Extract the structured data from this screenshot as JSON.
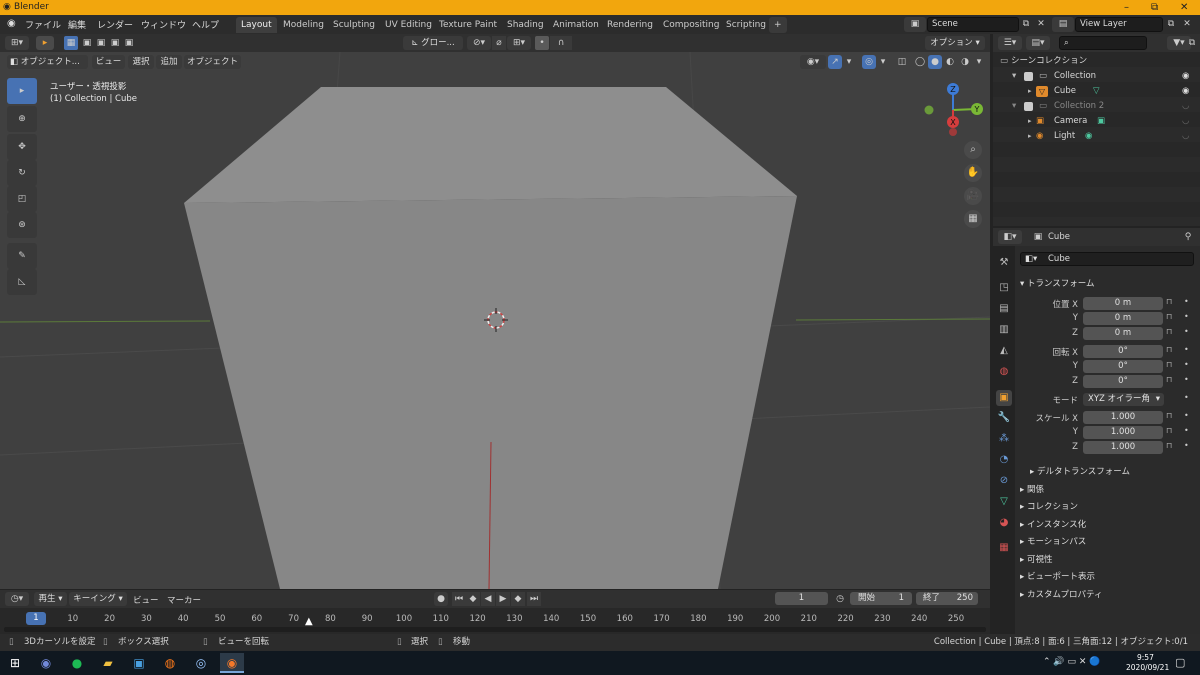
{
  "window": {
    "title": "Blender",
    "minimize": "–",
    "maximize": "⧉",
    "close": "✕"
  },
  "menus": [
    "ファイル",
    "編集",
    "レンダー",
    "ウィンドウ",
    "ヘルプ"
  ],
  "workspaces": [
    "Layout",
    "Modeling",
    "Sculpting",
    "UV Editing",
    "Texture Paint",
    "Shading",
    "Animation",
    "Rendering",
    "Compositing",
    "Scripting"
  ],
  "add_workspace": "+",
  "scene": {
    "name": "Scene",
    "view_layer": "View Layer"
  },
  "viewport_header": {
    "transform_orientation": "グロー...",
    "options": "オプション",
    "mode": "オブジェクト...",
    "menus": [
      "ビュー",
      "選択",
      "追加",
      "オブジェクト"
    ]
  },
  "viewport": {
    "view_name": "ユーザー・透視投影",
    "object_info": "(1) Collection | Cube",
    "gizmo_axes": {
      "z": "Z",
      "x": "X",
      "y": "Y"
    },
    "colors": {
      "background": "#404040",
      "cube_front": "#878787",
      "cube_top": "#8e8e8e",
      "cube_side": "#858585"
    }
  },
  "outliner": {
    "title": "シーンコレクション",
    "rows": [
      {
        "label": "Collection"
      },
      {
        "label": "Cube"
      },
      {
        "label": "Collection 2"
      },
      {
        "label": "Camera"
      },
      {
        "label": "Light"
      }
    ]
  },
  "properties": {
    "object_name": "Cube",
    "data_name": "Cube",
    "transform_title": "トランスフォーム",
    "location_label": "位置",
    "rotation_label": "回転",
    "mode_label": "モード",
    "scale_label": "スケール",
    "axes": [
      "X",
      "Y",
      "Z"
    ],
    "location": [
      "0 m",
      "0 m",
      "0 m"
    ],
    "rotation": [
      "0°",
      "0°",
      "0°"
    ],
    "mode_value": "XYZ オイラー角",
    "scale": [
      "1.000",
      "1.000",
      "1.000"
    ],
    "delta_transform": "デルタトランスフォーム",
    "sections": [
      "関係",
      "コレクション",
      "インスタンス化",
      "モーションパス",
      "可視性",
      "ビューポート表示",
      "カスタムプロパティ"
    ]
  },
  "timeline": {
    "playback": "再生",
    "keying": "キーイング",
    "view": "ビュー",
    "marker": "マーカー",
    "current_frame": "1",
    "start_label": "開始",
    "start": "1",
    "end_label": "終了",
    "end": "250",
    "ticks": [
      "10",
      "20",
      "30",
      "40",
      "50",
      "60",
      "70",
      "80",
      "90",
      "100",
      "110",
      "120",
      "130",
      "140",
      "150",
      "160",
      "170",
      "180",
      "190",
      "200",
      "210",
      "220",
      "230",
      "240",
      "250"
    ],
    "playhead": "1"
  },
  "statusbar": {
    "set_cursor": "3Dカーソルを設定",
    "box_select": "ボックス選択",
    "rotate_view": "ビューを回転",
    "select": "選択",
    "move": "移動",
    "stats": "Collection | Cube | 頂点:8 | 面:6 | 三角面:12 | オブジェクト:0/1"
  },
  "taskbar": {
    "time": "9:57",
    "date": "2020/09/21"
  }
}
